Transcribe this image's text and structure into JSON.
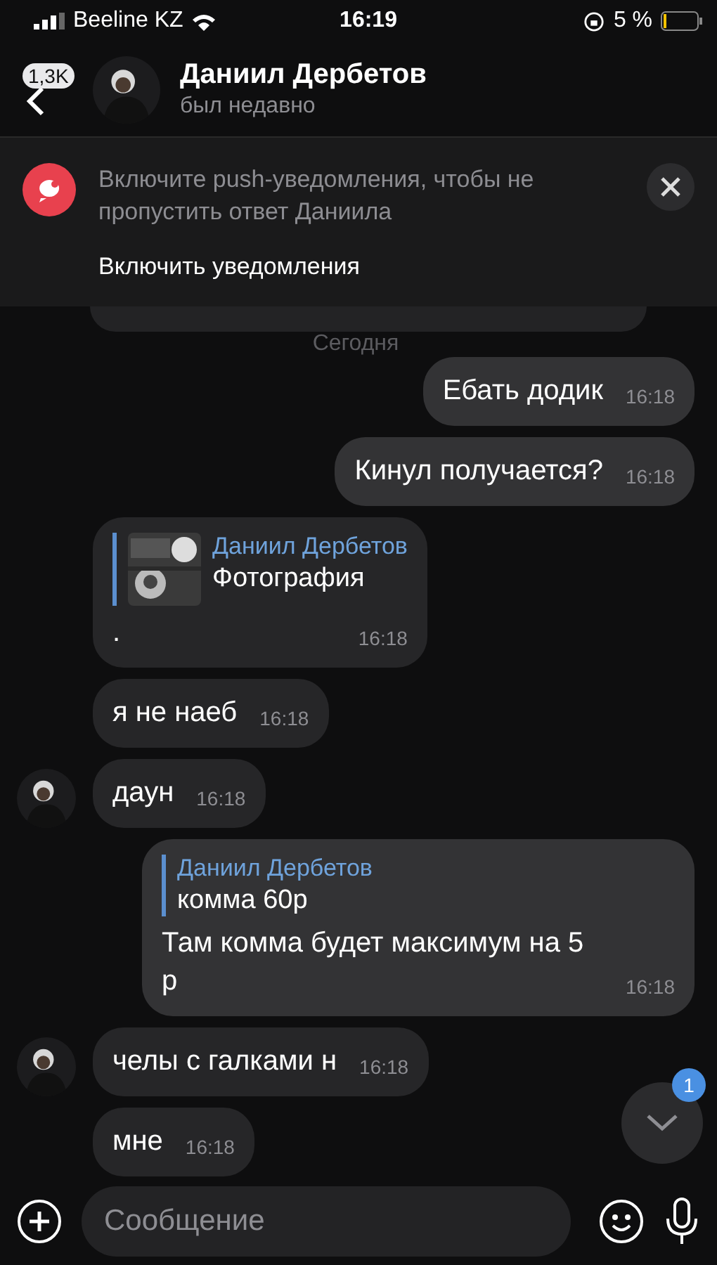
{
  "status_bar": {
    "carrier": "Beeline KZ",
    "time": "16:19",
    "battery": "5 %"
  },
  "header": {
    "back_badge": "1,3K",
    "name": "Даниил Дербетов",
    "status": "был недавно"
  },
  "banner": {
    "text": "Включите push-уведомления, чтобы не пропустить ответ Даниила",
    "action": "Включить уведомления"
  },
  "date_label": "Сегодня",
  "messages": [
    {
      "kind": "text",
      "outgoing": true,
      "text": "Ебать додик",
      "time": "16:18"
    },
    {
      "kind": "text",
      "outgoing": true,
      "text": "Кинул получается?",
      "time": "16:18"
    },
    {
      "kind": "reply",
      "outgoing": false,
      "reply": {
        "author": "Даниил Дербетов",
        "text": "Фотография",
        "photo": true
      },
      "text": ".",
      "time": "16:18",
      "avatar": false
    },
    {
      "kind": "text",
      "outgoing": false,
      "text": "я не наеб",
      "time": "16:18",
      "avatar": false
    },
    {
      "kind": "text",
      "outgoing": false,
      "text": "даун",
      "time": "16:18",
      "avatar": true
    },
    {
      "kind": "reply",
      "outgoing": true,
      "reply": {
        "author": "Даниил Дербетов",
        "text": "комма 60р",
        "photo": false
      },
      "text": "Там комма будет максимум на 5 р",
      "time": "16:18"
    },
    {
      "kind": "text",
      "outgoing": false,
      "text": "челы с галками н",
      "time": "16:18",
      "avatar": true
    },
    {
      "kind": "text",
      "outgoing": false,
      "text": "мне",
      "time": "16:18",
      "avatar": false
    }
  ],
  "scroll_button": {
    "badge": "1"
  },
  "input": {
    "placeholder": "Сообщение"
  }
}
